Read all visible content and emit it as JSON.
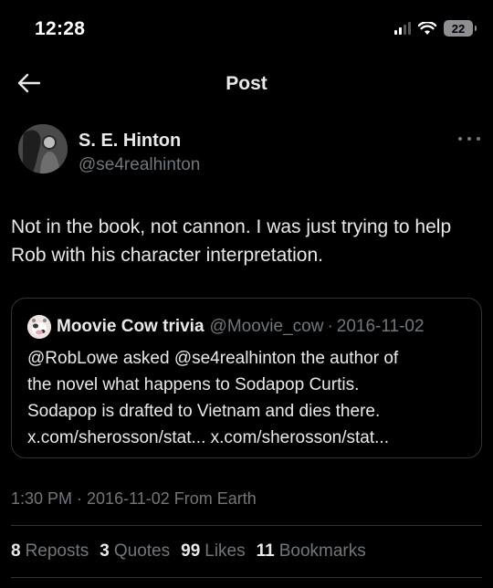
{
  "status_bar": {
    "time": "12:28",
    "battery": "22"
  },
  "nav": {
    "title": "Post"
  },
  "post": {
    "author_name": "S. E. Hinton",
    "author_handle": "@se4realhinton",
    "text": "Not in the book, not cannon. I was just trying to help Rob with his character interpretation.",
    "timestamp": "1:30 PM · 2016-11-02 From Earth"
  },
  "quote": {
    "name": "Moovie Cow trivia",
    "handle": "@Moovie_cow",
    "separator": "·",
    "date": "2016-11-02",
    "lines": [
      "@RobLowe asked @se4realhinton  the author of",
      "the novel what happens to Sodapop Curtis.",
      "Sodapop is drafted to Vietnam and dies there.",
      "x.com/sherosson/stat... x.com/sherosson/stat..."
    ]
  },
  "stats": [
    {
      "count": "8",
      "label": "Reposts"
    },
    {
      "count": "3",
      "label": "Quotes"
    },
    {
      "count": "99",
      "label": "Likes"
    },
    {
      "count": "11",
      "label": "Bookmarks"
    }
  ],
  "icons": {
    "back": "arrow-left-icon",
    "more": "ellipsis-icon",
    "signal": "cellular-signal-icon",
    "wifi": "wifi-icon",
    "battery": "battery-icon"
  },
  "colors": {
    "background": "#000000",
    "text": "#e7e9ea",
    "secondary": "#71767b",
    "border": "#2f3336"
  }
}
